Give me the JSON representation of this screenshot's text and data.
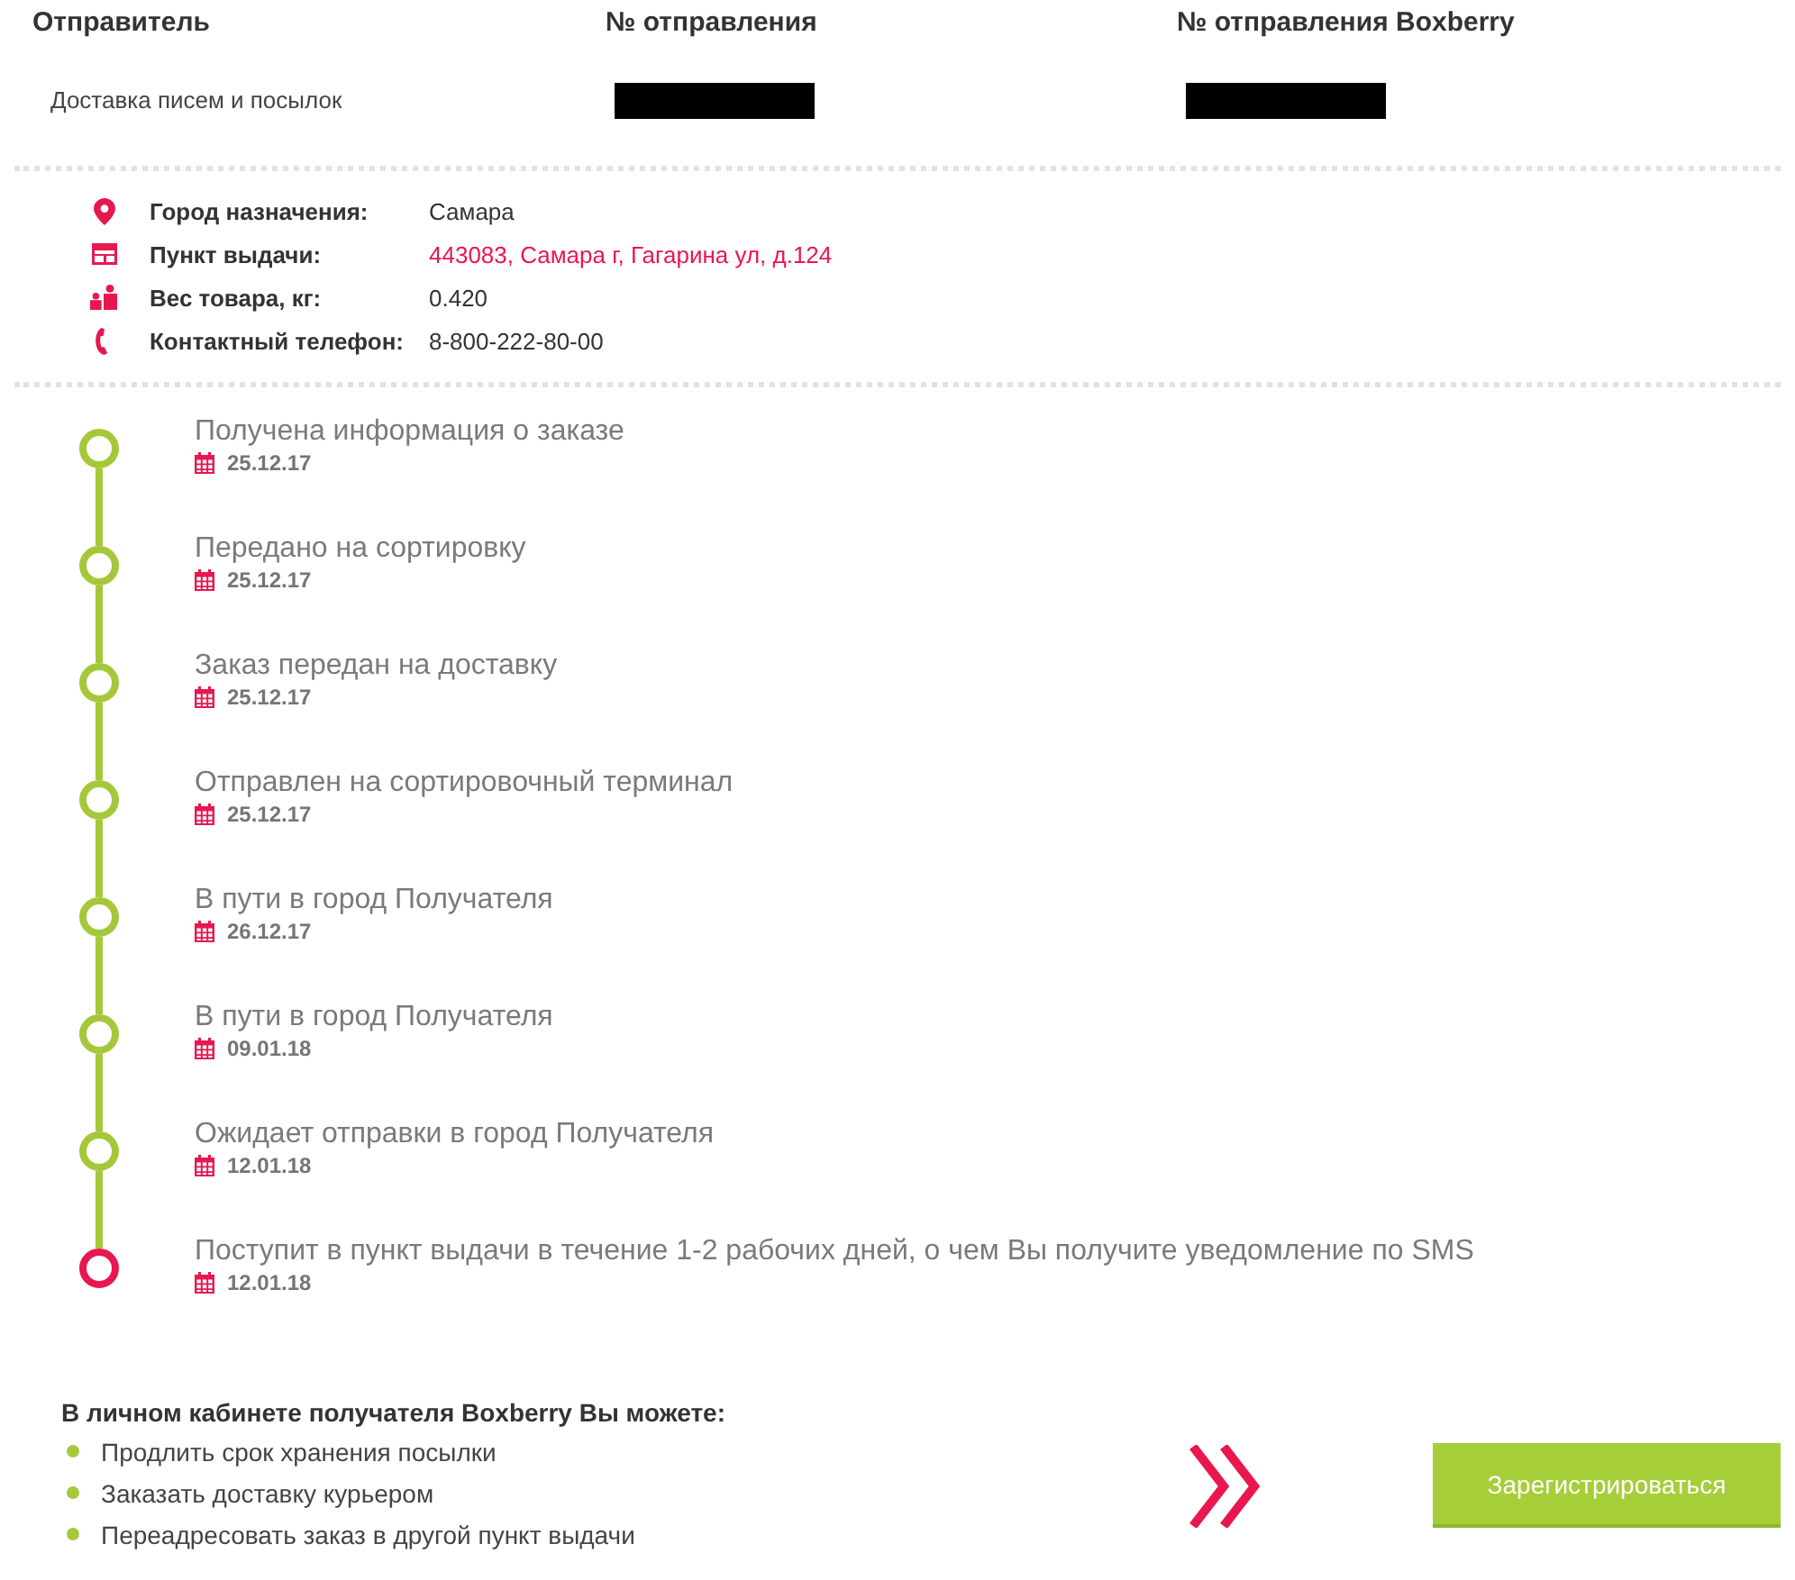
{
  "header": {
    "columns": [
      {
        "heading": "Отправитель",
        "value": "Доставка писем и посылок",
        "redacted": false
      },
      {
        "heading": "№ отправления",
        "redacted": true
      },
      {
        "heading": "№ отправления Boxberry",
        "redacted": true
      }
    ]
  },
  "details": [
    {
      "kind": "city",
      "label": "Город назначения:",
      "value": "Самара",
      "link": false
    },
    {
      "kind": "pickup",
      "label": "Пункт выдачи:",
      "value": "443083, Самара г, Гагарина ул, д.124",
      "link": true
    },
    {
      "kind": "weight",
      "label": "Вес товара, кг:",
      "value": "0.420",
      "link": false
    },
    {
      "kind": "phone",
      "label": "Контактный телефон:",
      "value": "8-800-222-80-00",
      "link": false
    }
  ],
  "tracking": {
    "events": [
      {
        "title": "Получена информация о заказе",
        "date": "25.12.17",
        "current": false
      },
      {
        "title": "Передано на сортировку",
        "date": "25.12.17",
        "current": false
      },
      {
        "title": "Заказ передан на доставку",
        "date": "25.12.17",
        "current": false
      },
      {
        "title": "Отправлен на сортировочный терминал",
        "date": "25.12.17",
        "current": false
      },
      {
        "title": "В пути в город Получателя",
        "date": "26.12.17",
        "current": false
      },
      {
        "title": "В пути в город Получателя",
        "date": "09.01.18",
        "current": false
      },
      {
        "title": "Ожидает отправки в город Получателя",
        "date": "12.01.18",
        "current": false
      },
      {
        "title": "Поступит в пункт выдачи в течение 1-2 рабочих дней, о чем Вы получите уведомление по SMS",
        "date": "12.01.18",
        "current": true
      }
    ]
  },
  "account_offer": {
    "heading": "В личном кабинете получателя Boxberry Вы можете:",
    "items": [
      "Продлить срок хранения посылки",
      "Заказать доставку курьером",
      "Переадресовать заказ в другой пункт выдачи"
    ],
    "register_button": "Зарегистрироваться"
  }
}
